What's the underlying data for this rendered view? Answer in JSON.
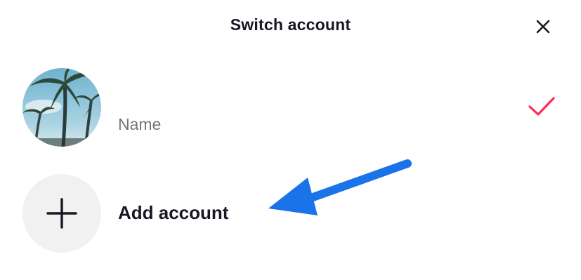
{
  "dialog": {
    "title": "Switch account",
    "close_icon": "close-icon"
  },
  "accounts": [
    {
      "username": "",
      "display_name": "Name",
      "selected": true,
      "avatar": "palm-trees-avatar",
      "check_color": "#fe2c55"
    }
  ],
  "add_account": {
    "label": "Add account",
    "icon": "plus-icon"
  },
  "annotation": {
    "arrow_icon": "arrow-pointer-icon",
    "arrow_color": "#1a73e8"
  }
}
